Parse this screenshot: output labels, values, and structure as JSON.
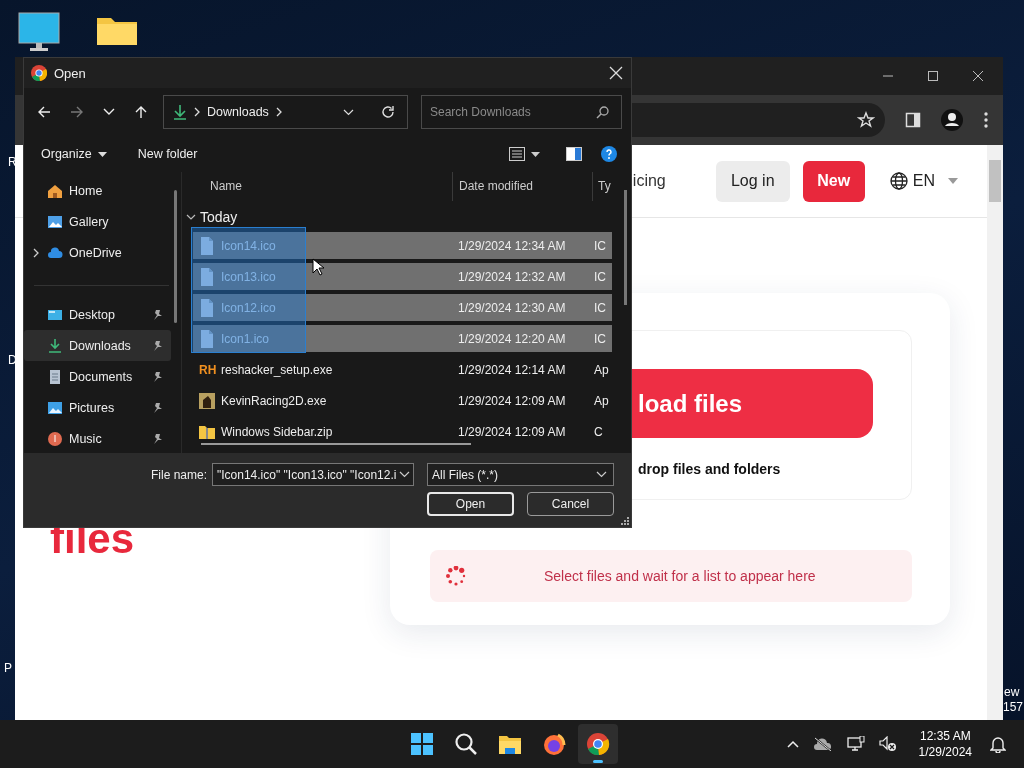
{
  "desktop": {
    "label_fragments": [
      "R",
      "D",
      "P",
      "ew",
      "157"
    ]
  },
  "browser": {
    "header": {
      "nav_link": "icing",
      "login": "Log in",
      "new": "New",
      "language": "EN"
    },
    "hero_fragment": "files",
    "upload_button": "load files",
    "drop_hint": "drop files and folders",
    "file_list_hint": "Select files and wait for a list to appear here"
  },
  "dialog": {
    "title": "Open",
    "nav": {
      "back_disabled": false,
      "forward_disabled": true
    },
    "breadcrumb": "Downloads",
    "search": {
      "placeholder": "Search Downloads"
    },
    "commands": {
      "organize": "Organize",
      "new_folder": "New folder"
    },
    "nav_pane": {
      "top": [
        {
          "label": "Home",
          "kind": "home",
          "selected": false
        },
        {
          "label": "Gallery",
          "kind": "gallery",
          "selected": false
        },
        {
          "label": "OneDrive",
          "kind": "cloud",
          "selected": false,
          "expanded": false
        }
      ],
      "pinned": [
        {
          "label": "Desktop",
          "kind": "desktop",
          "selected": false,
          "pinned": true
        },
        {
          "label": "Downloads",
          "kind": "downloads",
          "selected": true,
          "pinned": true
        },
        {
          "label": "Documents",
          "kind": "documents",
          "selected": false,
          "pinned": true
        },
        {
          "label": "Pictures",
          "kind": "pictures",
          "selected": false,
          "pinned": true
        },
        {
          "label": "Music",
          "kind": "music",
          "selected": false,
          "pinned": true
        }
      ]
    },
    "columns": [
      "Name",
      "Date modified",
      "Ty"
    ],
    "group": {
      "label": "Today",
      "expanded": true
    },
    "files": [
      {
        "name": "Icon14.ico",
        "date": "1/29/2024 12:34 AM",
        "type": "IC",
        "kind": "ico",
        "selected": true
      },
      {
        "name": "Icon13.ico",
        "date": "1/29/2024 12:32 AM",
        "type": "IC",
        "kind": "ico",
        "selected": true
      },
      {
        "name": "Icon12.ico",
        "date": "1/29/2024 12:30 AM",
        "type": "IC",
        "kind": "ico",
        "selected": true
      },
      {
        "name": "Icon1.ico",
        "date": "1/29/2024 12:20 AM",
        "type": "IC",
        "kind": "ico",
        "selected": true
      },
      {
        "name": "reshacker_setup.exe",
        "date": "1/29/2024 12:14 AM",
        "type": "Ap",
        "kind": "rh",
        "icon_text": "RH",
        "selected": false
      },
      {
        "name": "KevinRacing2D.exe",
        "date": "1/29/2024 12:09 AM",
        "type": "Ap",
        "kind": "app",
        "selected": false
      },
      {
        "name": "Windows Sidebar.zip",
        "date": "1/29/2024 12:09 AM",
        "type": "C",
        "kind": "zip",
        "selected": false
      }
    ],
    "file_name_label": "File name:",
    "file_name_value": "\"Icon14.ico\" \"Icon13.ico\" \"Icon12.i",
    "filter": "All Files (*.*)",
    "buttons": [
      "Open",
      "Cancel"
    ]
  },
  "taskbar": {
    "apps": [
      {
        "kind": "start",
        "active": false
      },
      {
        "kind": "search",
        "active": false
      },
      {
        "kind": "explorer",
        "active": false
      },
      {
        "kind": "firefox",
        "active": false
      },
      {
        "kind": "chrome",
        "active": true
      }
    ],
    "time": "12:35 AM",
    "date": "1/29/2024"
  }
}
